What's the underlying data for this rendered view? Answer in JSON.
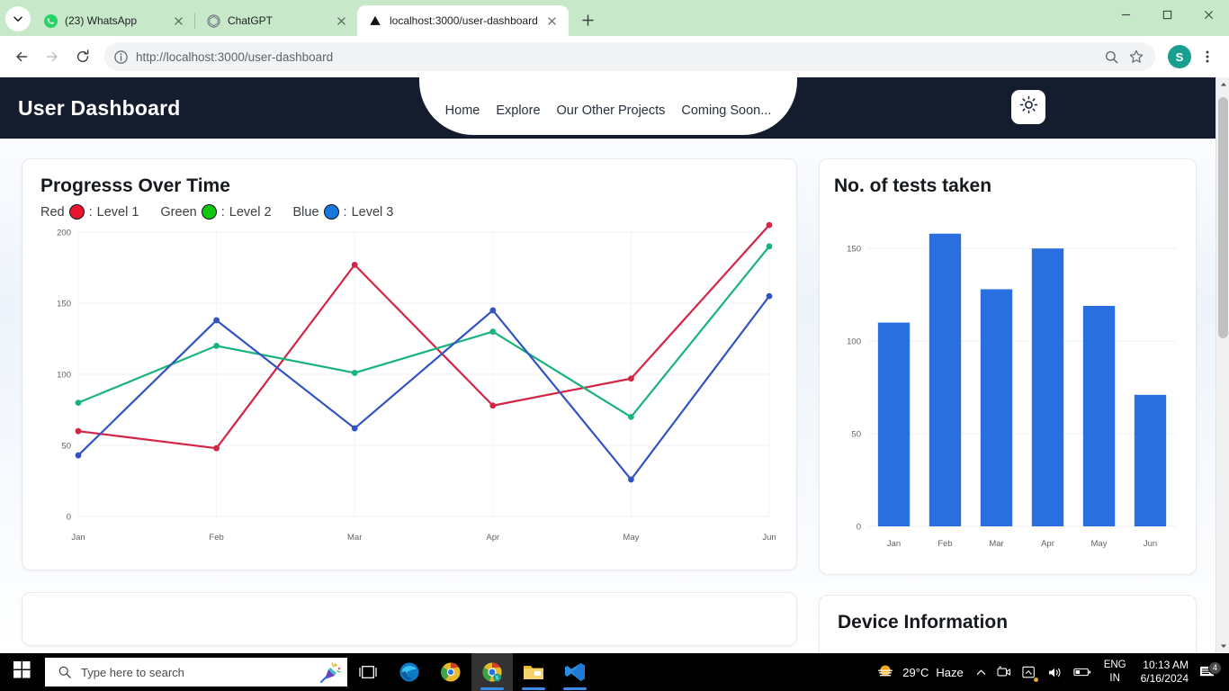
{
  "browser": {
    "tabs": [
      {
        "title": "(23) WhatsApp",
        "favicon": "whatsapp-icon",
        "active": false
      },
      {
        "title": "ChatGPT",
        "favicon": "chatgpt-icon",
        "active": false
      },
      {
        "title": "localhost:3000/user-dashboard",
        "favicon": "vercel-icon",
        "active": true
      }
    ],
    "new_tab_label": "+",
    "window_controls": {
      "minimize": "–",
      "maximize": "❐",
      "close": "✕"
    },
    "toolbar": {
      "back": "back-arrow",
      "forward": "forward-arrow",
      "reload": "reload-icon",
      "site_info": "info-icon",
      "url_prefix": "http://",
      "url_host": "localhost:3000",
      "url_path": "/user-dashboard",
      "url_full": "http://localhost:3000/user-dashboard",
      "zoom": "search-icon",
      "bookmark": "star-icon",
      "profile_initial": "S",
      "menu": "kebab-menu-icon"
    }
  },
  "page": {
    "navbar": {
      "brand": "User Dashboard",
      "links": [
        "Home",
        "Explore",
        "Our Other Projects",
        "Coming Soon..."
      ],
      "theme_toggle": "sun-icon"
    },
    "line_card": {
      "title": "Progresss Over Time",
      "legend": [
        {
          "name": "Red",
          "sep": ": ",
          "label": "Level 1",
          "color": "#e8152f"
        },
        {
          "name": "Green",
          "sep": ": ",
          "label": "Level 2",
          "color": "#12c712"
        },
        {
          "name": "Blue",
          "sep": ": ",
          "label": "Level 3",
          "color": "#1878e0"
        }
      ]
    },
    "bar_card": {
      "title": "No. of tests taken"
    },
    "device_card": {
      "title": "Device Information"
    }
  },
  "chart_data": [
    {
      "id": "progress-line-chart",
      "type": "line",
      "title": "Progresss Over Time",
      "categories": [
        "Jan",
        "Feb",
        "Mar",
        "Apr",
        "May",
        "Jun"
      ],
      "xlabel": "",
      "ylabel": "",
      "ylim": [
        0,
        200
      ],
      "yticks": [
        0,
        50,
        100,
        150,
        200
      ],
      "grid": true,
      "legend_position": "top-left",
      "series": [
        {
          "name": "Level 1",
          "legend_key": "Red",
          "color": "#d32546",
          "marker": "circle",
          "values": [
            60,
            48,
            177,
            78,
            97,
            205
          ]
        },
        {
          "name": "Level 2",
          "legend_key": "Green",
          "color": "#19b37c",
          "marker": "circle",
          "values": [
            80,
            120,
            101,
            130,
            70,
            190
          ]
        },
        {
          "name": "Level 3",
          "legend_key": "Blue",
          "color": "#3253c4",
          "marker": "circle",
          "values": [
            43,
            138,
            62,
            145,
            26,
            155
          ]
        }
      ]
    },
    {
      "id": "tests-taken-bar-chart",
      "type": "bar",
      "title": "No. of tests taken",
      "categories": [
        "Jan",
        "Feb",
        "Mar",
        "Apr",
        "May",
        "Jun"
      ],
      "values": [
        110,
        158,
        128,
        150,
        119,
        71
      ],
      "color": "#2a6fe0",
      "xlabel": "",
      "ylabel": "",
      "ylim": [
        0,
        170
      ],
      "yticks": [
        0,
        50,
        100,
        150
      ],
      "grid": true
    }
  ],
  "taskbar": {
    "start": "windows-logo-icon",
    "search_placeholder": "Type here to search",
    "search_icon": "magnifier-icon",
    "cortana": "confetti-icon",
    "task_view": "task-view-icon",
    "apps": [
      {
        "name": "edge-icon",
        "running": false,
        "active": false
      },
      {
        "name": "firefox-icon",
        "running": false,
        "active": false
      },
      {
        "name": "chrome-icon",
        "running": true,
        "active": true
      },
      {
        "name": "file-explorer-icon",
        "running": true,
        "active": false
      },
      {
        "name": "vscode-icon",
        "running": true,
        "active": false
      }
    ],
    "tray": {
      "weather_icon": "haze-icon",
      "weather_temp": "29°C",
      "weather_cond": "Haze",
      "show_hidden": "chevron-up-icon",
      "camera": "camera-icon",
      "onedrive": "onedrive-icon",
      "volume": "speaker-icon",
      "battery": "battery-icon",
      "lang_top": "ENG",
      "lang_bottom": "IN",
      "time": "10:13 AM",
      "date": "6/16/2024",
      "notifications_icon": "notification-icon",
      "notifications_count": "4"
    }
  }
}
